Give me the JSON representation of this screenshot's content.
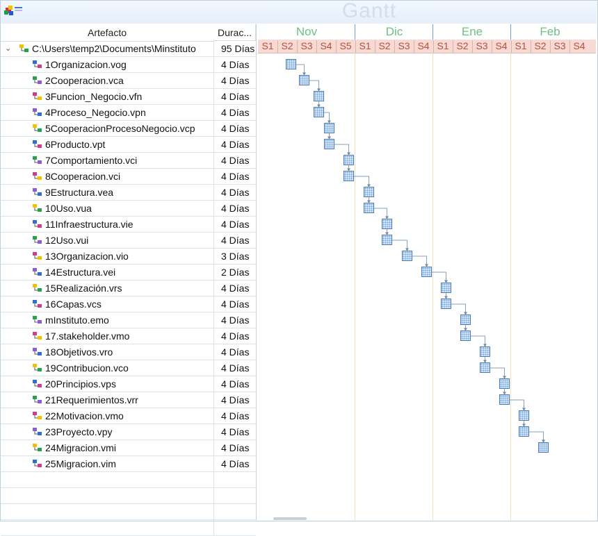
{
  "chart_title": "Gantt",
  "columns": {
    "artefacto": "Artefacto",
    "duracion": "Durac..."
  },
  "root": {
    "path": "C:\\Users\\temp2\\Documents\\Minstituto",
    "duration": "95 Días"
  },
  "months": [
    "Nov",
    "Dic",
    "Ene",
    "Feb"
  ],
  "weeks": [
    "S1",
    "S2",
    "S3",
    "S4",
    "S5",
    "S1",
    "S2",
    "S3",
    "S4",
    "S1",
    "S2",
    "S3",
    "S4",
    "S1",
    "S2",
    "S3",
    "S4"
  ],
  "items": [
    {
      "name": "1Organizacion.vog",
      "duration": "4 Días",
      "icon": "organization-icon"
    },
    {
      "name": "2Cooperacion.vca",
      "duration": "4 Días",
      "icon": "cooperation-icon"
    },
    {
      "name": "3Funcion_Negocio.vfn",
      "duration": "4 Días",
      "icon": "function-icon"
    },
    {
      "name": "4Proceso_Negocio.vpn",
      "duration": "4 Días",
      "icon": "process-icon"
    },
    {
      "name": "5CooperacionProcesoNegocio.vcp",
      "duration": "4 Días",
      "icon": "cooperation-process-icon"
    },
    {
      "name": "6Producto.vpt",
      "duration": "4 Días",
      "icon": "product-icon"
    },
    {
      "name": "7Comportamiento.vci",
      "duration": "4 Días",
      "icon": "behavior-icon"
    },
    {
      "name": "8Cooperacion.vci",
      "duration": "4 Días",
      "icon": "cooperation-app-icon"
    },
    {
      "name": "9Estructura.vea",
      "duration": "4 Días",
      "icon": "structure-icon"
    },
    {
      "name": "10Uso.vua",
      "duration": "4 Días",
      "icon": "usage-icon"
    },
    {
      "name": "11Infraestructura.vie",
      "duration": "4 Días",
      "icon": "infrastructure-icon"
    },
    {
      "name": "12Uso.vui",
      "duration": "4 Días",
      "icon": "infra-usage-icon"
    },
    {
      "name": "13Organizacion.vio",
      "duration": "3 Días",
      "icon": "implementation-org-icon"
    },
    {
      "name": "14Estructura.vei",
      "duration": "2 Días",
      "icon": "infra-structure-icon"
    },
    {
      "name": "15Realización.vrs",
      "duration": "4 Días",
      "icon": "realization-icon"
    },
    {
      "name": "16Capas.vcs",
      "duration": "4 Días",
      "icon": "layers-icon"
    },
    {
      "name": "mInstituto.emo",
      "duration": "4 Días",
      "icon": "model-icon"
    },
    {
      "name": "17.stakeholder.vmo",
      "duration": "4 Días",
      "icon": "stakeholder-icon"
    },
    {
      "name": "18Objetivos.vro",
      "duration": "4 Días",
      "icon": "goals-icon"
    },
    {
      "name": "19Contribucion.vco",
      "duration": "4 Días",
      "icon": "contribution-icon"
    },
    {
      "name": "20Principios.vps",
      "duration": "4 Días",
      "icon": "principles-icon"
    },
    {
      "name": "21Requerimientos.vrr",
      "duration": "4 Días",
      "icon": "requirements-icon"
    },
    {
      "name": "22Motivacion.vmo",
      "duration": "4 Días",
      "icon": "motivation-icon"
    },
    {
      "name": "23Proyecto.vpy",
      "duration": "4 Días",
      "icon": "project-icon"
    },
    {
      "name": "24Migracion.vmi",
      "duration": "4 Días",
      "icon": "migration-icon"
    },
    {
      "name": "25Migracion.vim",
      "duration": "4 Días",
      "icon": "migration-impl-icon"
    }
  ],
  "colors": {
    "month": "#6fbf84",
    "week": "#b3503e",
    "bar_border": "#4a79b8",
    "bar_fill": "#cfe3fb"
  }
}
